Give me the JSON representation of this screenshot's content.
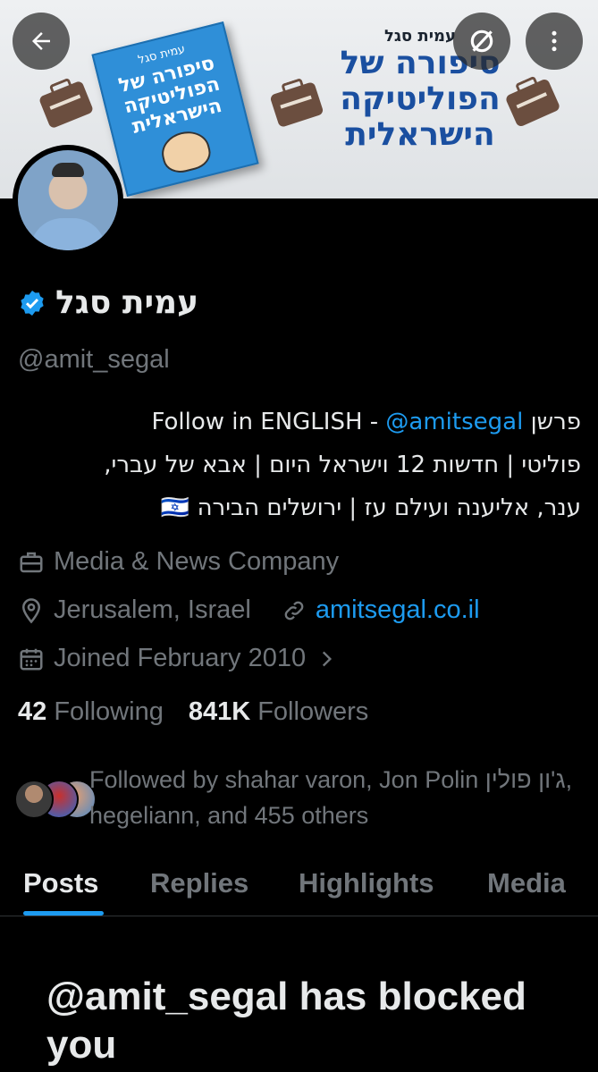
{
  "banner": {
    "book_author": "עמית סגל",
    "book_title": "סיפורה של הפוליטיקה הישראלית",
    "title_author": "עמית סגל",
    "title_lines": [
      "סיפורה של",
      "הפוליטיקה",
      "הישראלית"
    ]
  },
  "nav": {
    "back_icon": "arrow-left-icon",
    "grok_icon": "grok-icon",
    "more_icon": "more-vertical-icon"
  },
  "profile": {
    "name": "עמית סגל",
    "verified_icon": "verified-badge-icon",
    "handle": "@amit_segal",
    "bio_line1_prefix": "פרשן ",
    "bio_line1_mid": "Follow in ENGLISH - ",
    "bio_line1_link": "@amitsegal",
    "bio_line2": "פוליטי | חדשות 12 וישראל היום | אבא של עברי,",
    "bio_line3": "ענר, אליענה ועילם עז | ירושלים הבירה",
    "bio_flag": "🇮🇱",
    "category": "Media & News Company",
    "location": "Jerusalem, Israel",
    "website": "amitsegal.co.il",
    "joined": "Joined February 2010",
    "following_count": "42",
    "following_label": "Following",
    "followers_count": "841K",
    "followers_label": "Followers",
    "followed_by": "Followed by shahar varon, Jon Polin ג'ון פולין, hegeliann, and 455 others"
  },
  "tabs": [
    "Posts",
    "Replies",
    "Highlights",
    "Media"
  ],
  "active_tab": "Posts",
  "blocked_message": "@amit_segal has blocked you",
  "colors": {
    "accent": "#1d9bf0",
    "muted": "#71767b",
    "text": "#e7e9ea",
    "background": "#000000"
  }
}
